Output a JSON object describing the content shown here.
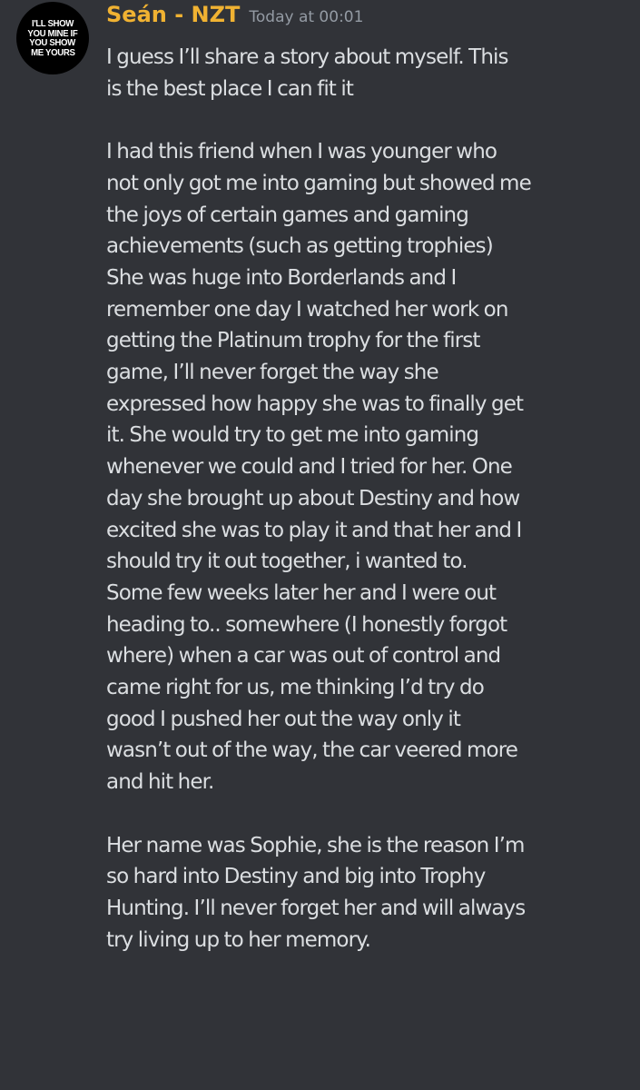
{
  "message": {
    "avatar": {
      "lines": [
        "I'LL SHOW",
        "YOU MINE IF",
        "YOU SHOW",
        "ME YOURS"
      ]
    },
    "author": "Seán - NZT",
    "timestamp": "Today at 00:01",
    "paragraphs": [
      "I guess I’ll share a story about myself. This\nis the best place I can fit it",
      "I had this friend when I was younger who\nnot only got me into gaming but showed me\nthe joys of certain games and gaming\nachievements (such as getting trophies)\nShe was huge into Borderlands and I\nremember one day I watched her work on\ngetting the Platinum trophy for the first\ngame, I’ll never forget the way she\nexpressed how happy she was to finally get\nit. She would try to get me into gaming\nwhenever we could and I tried for her. One\nday she brought up about Destiny and how\nexcited she was to play it and that her and I\nshould try it out together, i wanted to.\nSome few weeks later her and I were out\nheading to.. somewhere (I honestly forgot\nwhere) when a car was out of control and\ncame right for us, me thinking I’d try do\ngood I pushed her out the way only it\nwasn’t out of the way, the car veered more\nand hit her.",
      "Her name was Sophie, she is the reason I’m\nso hard into Destiny and big into Trophy\nHunting. I’ll never forget her and will always\ntry living up to her memory."
    ]
  },
  "colors": {
    "background": "#313338",
    "username": "#f0b232",
    "timestamp": "#949ba4",
    "text": "#dbdee1"
  }
}
